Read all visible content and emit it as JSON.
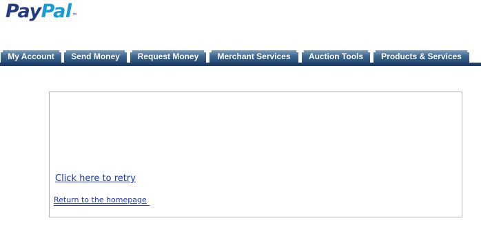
{
  "logo": {
    "part1": "Pay",
    "part2": "Pal",
    "trademark": "™"
  },
  "nav": {
    "tabs": [
      {
        "label": "My Account"
      },
      {
        "label": "Send Money"
      },
      {
        "label": "Request Money"
      },
      {
        "label": "Merchant Services"
      },
      {
        "label": "Auction Tools"
      },
      {
        "label": "Products & Services"
      }
    ]
  },
  "content": {
    "retry_link": "Click here to retry",
    "home_link": "Return to the homepage"
  },
  "colors": {
    "brand_dark": "#253b80",
    "brand_light": "#179bd7",
    "nav_bar": "#1f3f6b",
    "link": "#1a35c2"
  }
}
